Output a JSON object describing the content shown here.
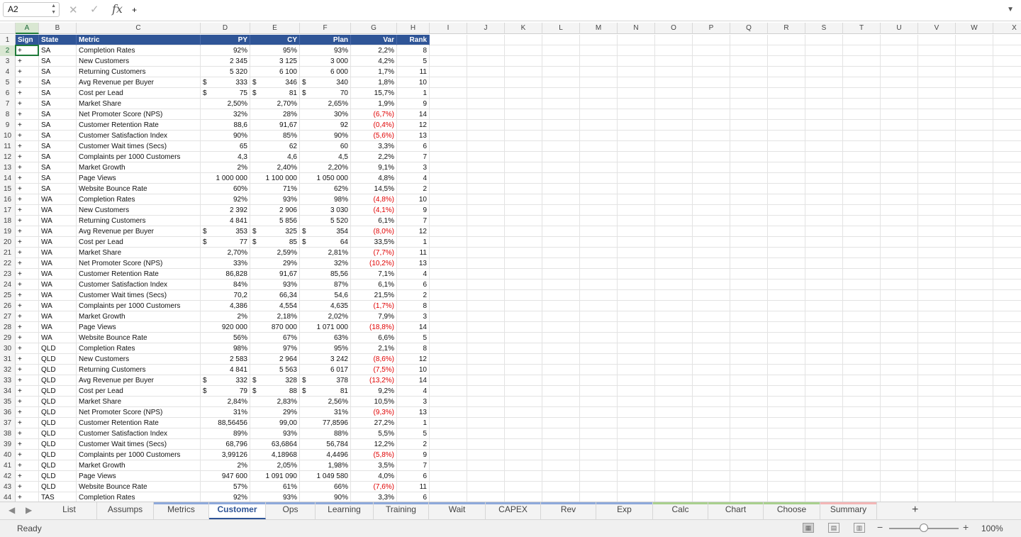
{
  "formula_bar": {
    "name_box": "A2",
    "fx_label": "fx",
    "formula": "+"
  },
  "columns": [
    "A",
    "B",
    "C",
    "D",
    "E",
    "F",
    "G",
    "H",
    "I",
    "J",
    "K",
    "L",
    "M",
    "N",
    "O",
    "P",
    "Q",
    "R",
    "S",
    "T",
    "U",
    "V",
    "W",
    "X"
  ],
  "header": {
    "sign": "Sign",
    "state": "State",
    "metric": "Metric",
    "py": "PY",
    "cy": "CY",
    "plan": "Plan",
    "var": "Var",
    "rank": "Rank"
  },
  "currency_symbol": "$",
  "rows": [
    {
      "n": "2",
      "sign": "+",
      "state": "SA",
      "metric": "Completion Rates",
      "py": "92%",
      "cy": "95%",
      "plan": "93%",
      "var": "2,2%",
      "rank": "8"
    },
    {
      "n": "3",
      "sign": "+",
      "state": "SA",
      "metric": "New Customers",
      "py": "2 345",
      "cy": "3 125",
      "plan": "3 000",
      "var": "4,2%",
      "rank": "5"
    },
    {
      "n": "4",
      "sign": "+",
      "state": "SA",
      "metric": "Returning Customers",
      "py": "5 320",
      "cy": "6 100",
      "plan": "6 000",
      "var": "1,7%",
      "rank": "11"
    },
    {
      "n": "5",
      "sign": "+",
      "state": "SA",
      "metric": "Avg Revenue per Buyer",
      "cur": true,
      "py": "333",
      "cy": "346",
      "plan": "340",
      "var": "1,8%",
      "rank": "10"
    },
    {
      "n": "6",
      "sign": "+",
      "state": "SA",
      "metric": "Cost per Lead",
      "cur": true,
      "py": "75",
      "cy": "81",
      "plan": "70",
      "var": "15,7%",
      "rank": "1"
    },
    {
      "n": "7",
      "sign": "+",
      "state": "SA",
      "metric": "Market Share",
      "py": "2,50%",
      "cy": "2,70%",
      "plan": "2,65%",
      "var": "1,9%",
      "rank": "9"
    },
    {
      "n": "8",
      "sign": "+",
      "state": "SA",
      "metric": "Net Promoter Score (NPS)",
      "py": "32%",
      "cy": "28%",
      "plan": "30%",
      "var": "(6,7%)",
      "neg": true,
      "rank": "14"
    },
    {
      "n": "9",
      "sign": "+",
      "state": "SA",
      "metric": "Customer Retention Rate",
      "py": "88,6",
      "cy": "91,67",
      "plan": "92",
      "var": "(0,4%)",
      "neg": true,
      "rank": "12"
    },
    {
      "n": "10",
      "sign": "+",
      "state": "SA",
      "metric": "Customer Satisfaction Index",
      "py": "90%",
      "cy": "85%",
      "plan": "90%",
      "var": "(5,6%)",
      "neg": true,
      "rank": "13"
    },
    {
      "n": "11",
      "sign": "+",
      "state": "SA",
      "metric": "Customer Wait times (Secs)",
      "py": "65",
      "cy": "62",
      "plan": "60",
      "var": "3,3%",
      "rank": "6"
    },
    {
      "n": "12",
      "sign": "+",
      "state": "SA",
      "metric": "Complaints per 1000 Customers",
      "py": "4,3",
      "cy": "4,6",
      "plan": "4,5",
      "var": "2,2%",
      "rank": "7"
    },
    {
      "n": "13",
      "sign": "+",
      "state": "SA",
      "metric": "Market Growth",
      "py": "2%",
      "cy": "2,40%",
      "plan": "2,20%",
      "var": "9,1%",
      "rank": "3"
    },
    {
      "n": "14",
      "sign": "+",
      "state": "SA",
      "metric": "Page Views",
      "py": "1 000 000",
      "cy": "1 100 000",
      "plan": "1 050 000",
      "var": "4,8%",
      "rank": "4"
    },
    {
      "n": "15",
      "sign": "+",
      "state": "SA",
      "metric": "Website Bounce Rate",
      "py": "60%",
      "cy": "71%",
      "plan": "62%",
      "var": "14,5%",
      "rank": "2"
    },
    {
      "n": "16",
      "sign": "+",
      "state": "WA",
      "metric": "Completion Rates",
      "py": "92%",
      "cy": "93%",
      "plan": "98%",
      "var": "(4,8%)",
      "neg": true,
      "rank": "10"
    },
    {
      "n": "17",
      "sign": "+",
      "state": "WA",
      "metric": "New Customers",
      "py": "2 392",
      "cy": "2 906",
      "plan": "3 030",
      "var": "(4,1%)",
      "neg": true,
      "rank": "9"
    },
    {
      "n": "18",
      "sign": "+",
      "state": "WA",
      "metric": "Returning Customers",
      "py": "4 841",
      "cy": "5 856",
      "plan": "5 520",
      "var": "6,1%",
      "rank": "7"
    },
    {
      "n": "19",
      "sign": "+",
      "state": "WA",
      "metric": "Avg Revenue per Buyer",
      "cur": true,
      "py": "353",
      "cy": "325",
      "plan": "354",
      "var": "(8,0%)",
      "neg": true,
      "rank": "12"
    },
    {
      "n": "20",
      "sign": "+",
      "state": "WA",
      "metric": "Cost per Lead",
      "cur": true,
      "py": "77",
      "cy": "85",
      "plan": "64",
      "var": "33,5%",
      "rank": "1"
    },
    {
      "n": "21",
      "sign": "+",
      "state": "WA",
      "metric": "Market Share",
      "py": "2,70%",
      "cy": "2,59%",
      "plan": "2,81%",
      "var": "(7,7%)",
      "neg": true,
      "rank": "11"
    },
    {
      "n": "22",
      "sign": "+",
      "state": "WA",
      "metric": "Net Promoter Score (NPS)",
      "py": "33%",
      "cy": "29%",
      "plan": "32%",
      "var": "(10,2%)",
      "neg": true,
      "rank": "13"
    },
    {
      "n": "23",
      "sign": "+",
      "state": "WA",
      "metric": "Customer Retention Rate",
      "py": "86,828",
      "cy": "91,67",
      "plan": "85,56",
      "var": "7,1%",
      "rank": "4"
    },
    {
      "n": "24",
      "sign": "+",
      "state": "WA",
      "metric": "Customer Satisfaction Index",
      "py": "84%",
      "cy": "93%",
      "plan": "87%",
      "var": "6,1%",
      "rank": "6"
    },
    {
      "n": "25",
      "sign": "+",
      "state": "WA",
      "metric": "Customer Wait times (Secs)",
      "py": "70,2",
      "cy": "66,34",
      "plan": "54,6",
      "var": "21,5%",
      "rank": "2"
    },
    {
      "n": "26",
      "sign": "+",
      "state": "WA",
      "metric": "Complaints per 1000 Customers",
      "py": "4,386",
      "cy": "4,554",
      "plan": "4,635",
      "var": "(1,7%)",
      "neg": true,
      "rank": "8"
    },
    {
      "n": "27",
      "sign": "+",
      "state": "WA",
      "metric": "Market Growth",
      "py": "2%",
      "cy": "2,18%",
      "plan": "2,02%",
      "var": "7,9%",
      "rank": "3"
    },
    {
      "n": "28",
      "sign": "+",
      "state": "WA",
      "metric": "Page Views",
      "py": "920 000",
      "cy": "870 000",
      "plan": "1 071 000",
      "var": "(18,8%)",
      "neg": true,
      "rank": "14"
    },
    {
      "n": "29",
      "sign": "+",
      "state": "WA",
      "metric": "Website Bounce Rate",
      "py": "56%",
      "cy": "67%",
      "plan": "63%",
      "var": "6,6%",
      "rank": "5"
    },
    {
      "n": "30",
      "sign": "+",
      "state": "QLD",
      "metric": "Completion Rates",
      "py": "98%",
      "cy": "97%",
      "plan": "95%",
      "var": "2,1%",
      "rank": "8"
    },
    {
      "n": "31",
      "sign": "+",
      "state": "QLD",
      "metric": "New Customers",
      "py": "2 583",
      "cy": "2 964",
      "plan": "3 242",
      "var": "(8,6%)",
      "neg": true,
      "rank": "12"
    },
    {
      "n": "32",
      "sign": "+",
      "state": "QLD",
      "metric": "Returning Customers",
      "py": "4 841",
      "cy": "5 563",
      "plan": "6 017",
      "var": "(7,5%)",
      "neg": true,
      "rank": "10"
    },
    {
      "n": "33",
      "sign": "+",
      "state": "QLD",
      "metric": "Avg Revenue per Buyer",
      "cur": true,
      "py": "332",
      "cy": "328",
      "plan": "378",
      "var": "(13,2%)",
      "neg": true,
      "rank": "14"
    },
    {
      "n": "34",
      "sign": "+",
      "state": "QLD",
      "metric": "Cost per Lead",
      "cur": true,
      "py": "79",
      "cy": "88",
      "plan": "81",
      "var": "9,2%",
      "rank": "4"
    },
    {
      "n": "35",
      "sign": "+",
      "state": "QLD",
      "metric": "Market Share",
      "py": "2,84%",
      "cy": "2,83%",
      "plan": "2,56%",
      "var": "10,5%",
      "rank": "3"
    },
    {
      "n": "36",
      "sign": "+",
      "state": "QLD",
      "metric": "Net Promoter Score (NPS)",
      "py": "31%",
      "cy": "29%",
      "plan": "31%",
      "var": "(9,3%)",
      "neg": true,
      "rank": "13"
    },
    {
      "n": "37",
      "sign": "+",
      "state": "QLD",
      "metric": "Customer Retention Rate",
      "py": "88,56456",
      "cy": "99,00",
      "plan": "77,8596",
      "var": "27,2%",
      "rank": "1"
    },
    {
      "n": "38",
      "sign": "+",
      "state": "QLD",
      "metric": "Customer Satisfaction Index",
      "py": "89%",
      "cy": "93%",
      "plan": "88%",
      "var": "5,5%",
      "rank": "5"
    },
    {
      "n": "39",
      "sign": "+",
      "state": "QLD",
      "metric": "Customer Wait times (Secs)",
      "py": "68,796",
      "cy": "63,6864",
      "plan": "56,784",
      "var": "12,2%",
      "rank": "2"
    },
    {
      "n": "40",
      "sign": "+",
      "state": "QLD",
      "metric": "Complaints per 1000 Customers",
      "py": "3,99126",
      "cy": "4,18968",
      "plan": "4,4496",
      "var": "(5,8%)",
      "neg": true,
      "rank": "9"
    },
    {
      "n": "41",
      "sign": "+",
      "state": "QLD",
      "metric": "Market Growth",
      "py": "2%",
      "cy": "2,05%",
      "plan": "1,98%",
      "var": "3,5%",
      "rank": "7"
    },
    {
      "n": "42",
      "sign": "+",
      "state": "QLD",
      "metric": "Page Views",
      "py": "947 600",
      "cy": "1 091 090",
      "plan": "1 049 580",
      "var": "4,0%",
      "rank": "6"
    },
    {
      "n": "43",
      "sign": "+",
      "state": "QLD",
      "metric": "Website Bounce Rate",
      "py": "57%",
      "cy": "61%",
      "plan": "66%",
      "var": "(7,6%)",
      "neg": true,
      "rank": "11"
    },
    {
      "n": "44",
      "sign": "+",
      "state": "TAS",
      "metric": "Completion Rates",
      "py": "92%",
      "cy": "93%",
      "plan": "90%",
      "var": "3,3%",
      "rank": "6"
    }
  ],
  "sheet_tabs": [
    {
      "label": "List",
      "color": ""
    },
    {
      "label": "Assumps",
      "color": ""
    },
    {
      "label": "Metrics",
      "color": "#8ea9db"
    },
    {
      "label": "Customer",
      "color": "#8ea9db",
      "active": true
    },
    {
      "label": "Ops",
      "color": "#8ea9db"
    },
    {
      "label": "Learning",
      "color": "#8ea9db"
    },
    {
      "label": "Training",
      "color": "#8ea9db"
    },
    {
      "label": "Wait",
      "color": "#8ea9db"
    },
    {
      "label": "CAPEX",
      "color": "#8ea9db"
    },
    {
      "label": "Rev",
      "color": "#8ea9db"
    },
    {
      "label": "Exp",
      "color": "#8ea9db"
    },
    {
      "label": "Calc",
      "color": "#a9d08e"
    },
    {
      "label": "Chart",
      "color": "#a9d08e"
    },
    {
      "label": "Choose",
      "color": "#a9d08e"
    },
    {
      "label": "Summary",
      "color": "#f4b6b6"
    }
  ],
  "status": {
    "ready": "Ready",
    "zoom": "100%"
  },
  "colors": {
    "header_fill": "#2f5597",
    "negative": "#e00000",
    "selection": "#1f7a3a"
  }
}
